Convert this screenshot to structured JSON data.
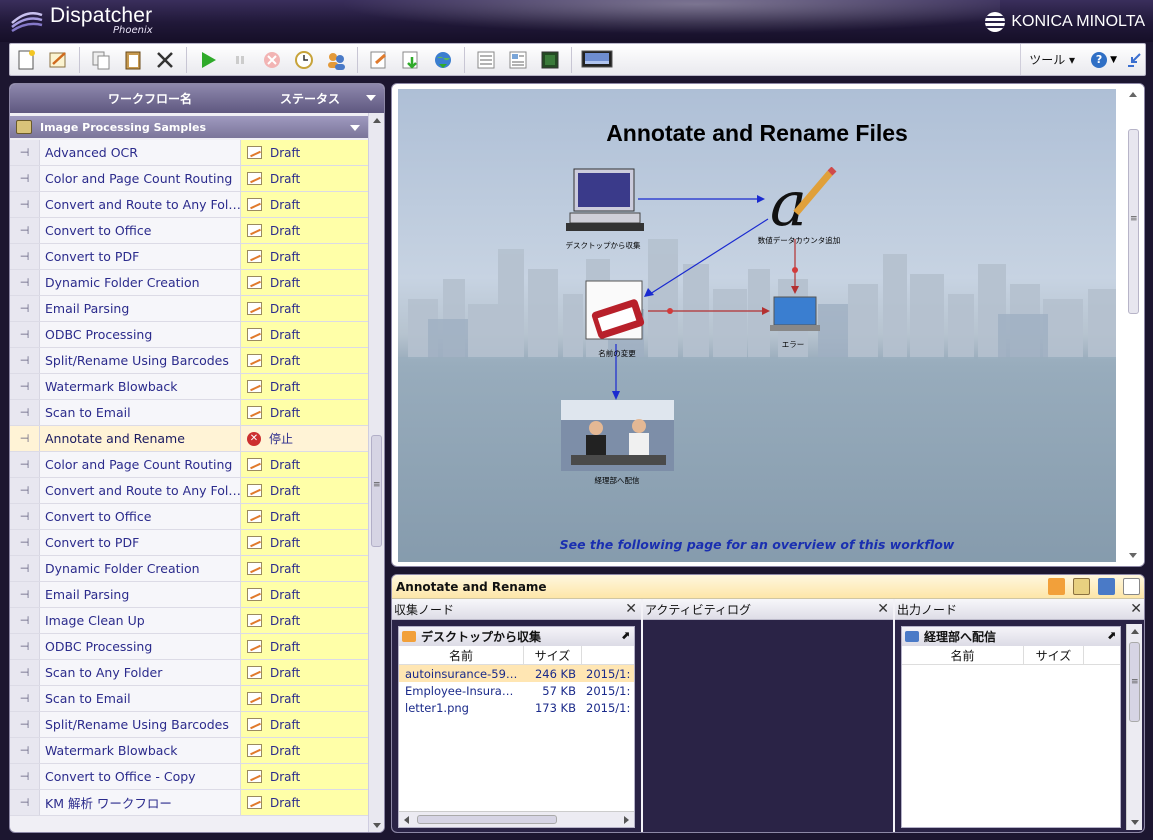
{
  "app": {
    "name": "Dispatcher",
    "sub": "Phoenix",
    "vendor": "KONICA MINOLTA"
  },
  "toolbar": {
    "tools_label": "ツール ▾",
    "help_label": "?"
  },
  "list": {
    "col_name": "ワークフロー名",
    "col_status": "ステータス",
    "group": "Image Processing Samples",
    "rows": [
      {
        "name": "Advanced OCR",
        "status": "Draft"
      },
      {
        "name": "Color and Page Count Routing",
        "status": "Draft"
      },
      {
        "name": "Convert and Route to Any Fol…",
        "status": "Draft"
      },
      {
        "name": "Convert to Office",
        "status": "Draft"
      },
      {
        "name": "Convert to PDF",
        "status": "Draft"
      },
      {
        "name": "Dynamic Folder Creation",
        "status": "Draft"
      },
      {
        "name": "Email Parsing",
        "status": "Draft"
      },
      {
        "name": "ODBC Processing",
        "status": "Draft"
      },
      {
        "name": "Split/Rename Using Barcodes",
        "status": "Draft"
      },
      {
        "name": "Watermark Blowback",
        "status": "Draft"
      },
      {
        "name": "Scan to Email",
        "status": "Draft"
      },
      {
        "name": "Annotate and Rename",
        "status": "停止"
      },
      {
        "name": "Color and Page Count Routing",
        "status": "Draft"
      },
      {
        "name": "Convert and Route to Any Fol…",
        "status": "Draft"
      },
      {
        "name": "Convert to Office",
        "status": "Draft"
      },
      {
        "name": "Convert to PDF",
        "status": "Draft"
      },
      {
        "name": "Dynamic Folder Creation",
        "status": "Draft"
      },
      {
        "name": "Email Parsing",
        "status": "Draft"
      },
      {
        "name": "Image Clean Up",
        "status": "Draft"
      },
      {
        "name": "ODBC Processing",
        "status": "Draft"
      },
      {
        "name": "Scan to Any Folder",
        "status": "Draft"
      },
      {
        "name": "Scan to Email",
        "status": "Draft"
      },
      {
        "name": "Split/Rename Using Barcodes",
        "status": "Draft"
      },
      {
        "name": "Watermark Blowback",
        "status": "Draft"
      },
      {
        "name": "Convert to Office - Copy",
        "status": "Draft"
      },
      {
        "name": "KM 解析 ワークフロー",
        "status": "Draft"
      }
    ]
  },
  "canvas": {
    "title": "Annotate and Rename Files",
    "nodes": {
      "collect": "デスクトップから収集",
      "annotate": "数値データカウンタ追加",
      "rename": "名前の変更",
      "error": "エラー",
      "deliver": "経理部へ配信"
    },
    "footer": "See the following page for an overview of this workflow"
  },
  "bottom": {
    "title": "Annotate and Rename",
    "collect_pane": "収集ノード",
    "activity_pane": "アクティビティログ",
    "output_pane": "出力ノード",
    "collect_node": "デスクトップから収集",
    "output_node": "経理部へ配信",
    "col_name": "名前",
    "col_size": "サイズ",
    "files": [
      {
        "name": "autoinsurance-59…",
        "size": "246 KB",
        "date": "2015/1:"
      },
      {
        "name": "Employee-Insura…",
        "size": "57 KB",
        "date": "2015/1:"
      },
      {
        "name": "letter1.png",
        "size": "173 KB",
        "date": "2015/1:"
      }
    ]
  },
  "colors": {
    "accent": "#2b2b8c",
    "draft_bg": "#ffffa8",
    "header": "#201838"
  }
}
